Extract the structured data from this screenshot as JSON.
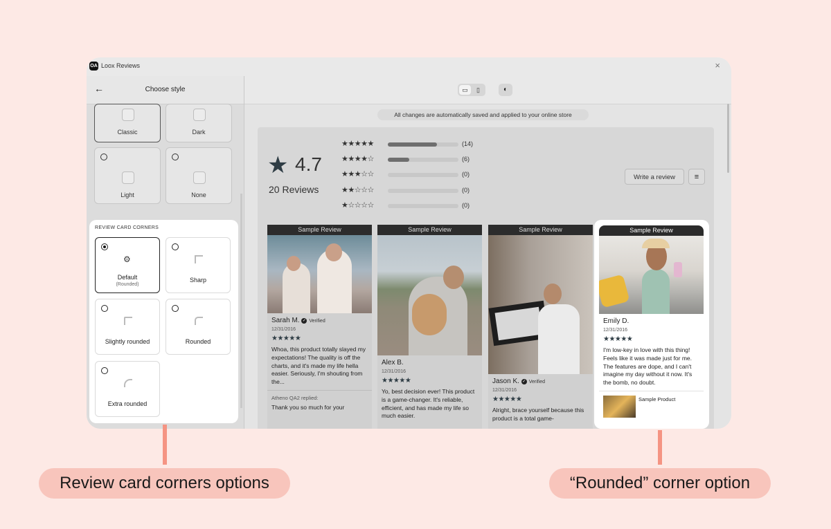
{
  "window": {
    "app_logo": "OA",
    "app_title": "Loox Reviews",
    "close_glyph": "×"
  },
  "sidebar": {
    "back_glyph": "←",
    "title": "Choose style",
    "styles": [
      {
        "label": "Classic"
      },
      {
        "label": "Dark"
      },
      {
        "label": "Light"
      },
      {
        "label": "None"
      }
    ],
    "corners_heading": "REVIEW CARD CORNERS",
    "corners": [
      {
        "label": "Default",
        "sub": "(Rounded)",
        "selected": true
      },
      {
        "label": "Sharp",
        "selected": false
      },
      {
        "label": "Slightly rounded",
        "selected": false
      },
      {
        "label": "Rounded",
        "selected": false
      },
      {
        "label": "Extra rounded",
        "selected": false
      }
    ]
  },
  "toolbar": {
    "desktop_icon": "▭",
    "mobile_icon": "▯",
    "theme_icon": "◐"
  },
  "preview": {
    "saved_notice": "All changes are automatically saved and applied to your online store",
    "average": "4.7",
    "total_reviews": "20 Reviews",
    "distribution": [
      {
        "stars": "★★★★★",
        "count": "(14)",
        "fraction": 0.7
      },
      {
        "stars": "★★★★☆",
        "count": "(6)",
        "fraction": 0.3
      },
      {
        "stars": "★★★☆☆",
        "count": "(0)",
        "fraction": 0
      },
      {
        "stars": "★★☆☆☆",
        "count": "(0)",
        "fraction": 0
      },
      {
        "stars": "★☆☆☆☆",
        "count": "(0)",
        "fraction": 0
      }
    ],
    "write_review": "Write a review",
    "big_star": "★",
    "filter_icon": "≡",
    "reviews": [
      {
        "tag": "Sample Review",
        "name": "Sarah M.",
        "verified": "Verified",
        "date": "12/31/2016",
        "stars": "★★★★★",
        "text": "Whoa, this product totally slayed my expectations! The quality is off the charts, and it's made my life hella easier. Seriously, I'm shouting from the...",
        "replied": "Atheno QA2 replied:",
        "reply": "Thank you so much for your"
      },
      {
        "tag": "Sample Review",
        "name": "Alex B.",
        "date": "12/31/2016",
        "stars": "★★★★★",
        "text": "Yo, best decision ever! This product is a game-changer. It's reliable, efficient, and has made my life so much easier."
      },
      {
        "tag": "Sample Review",
        "name": "Jason K.",
        "verified": "Verified",
        "date": "12/31/2016",
        "stars": "★★★★★",
        "text": "Alright, brace yourself because this product is a total game-"
      },
      {
        "tag": "Sample Review",
        "name": "Emily D.",
        "date": "12/31/2016",
        "stars": "★★★★★",
        "text": "I'm low-key in love with this thing! Feels like it was made just for me. The features are dope, and I can't imagine my day without it now. It's the bomb, no doubt.",
        "product": "Sample Product"
      }
    ]
  },
  "callouts": {
    "left": "Review card corners options",
    "right": "“Rounded” corner option"
  },
  "colors": {
    "background": "#fde9e5",
    "callout_fill": "#f8c5bc",
    "callout_line": "#f59483",
    "star": "#2f3d45"
  }
}
